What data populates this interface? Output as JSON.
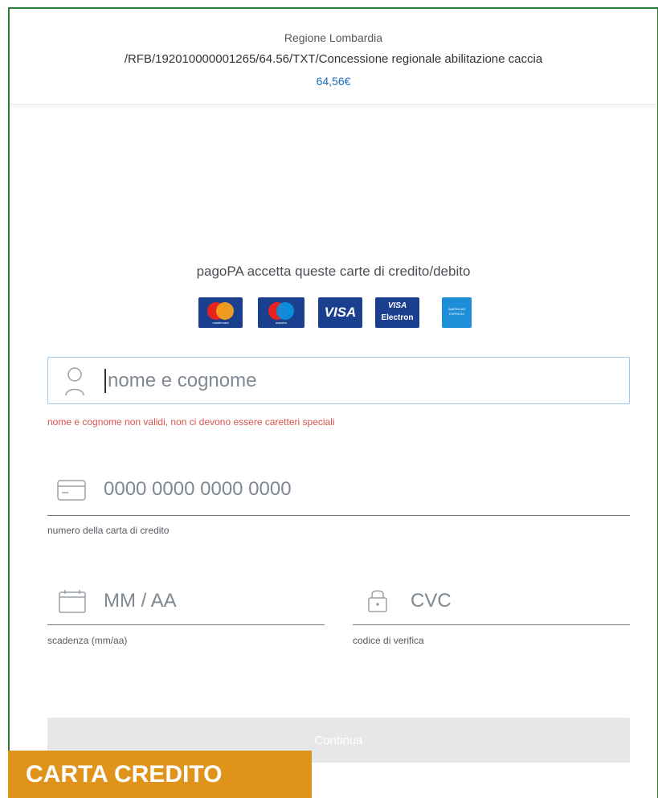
{
  "header": {
    "organization": "Regione Lombardia",
    "causale": "/RFB/192010000001265/64.56/TXT/Concessione regionale abilitazione caccia",
    "amount": "64,56€"
  },
  "accepted_cards": {
    "title": "pagoPA accetta queste carte di credito/debito",
    "logos": [
      {
        "name": "mastercard",
        "label": "mastercard"
      },
      {
        "name": "maestro",
        "label": "maestro"
      },
      {
        "name": "visa",
        "label": "VISA"
      },
      {
        "name": "visa-electron",
        "label_top": "VISA",
        "label_bottom": "Electron"
      },
      {
        "name": "american-express",
        "label": "AMERICAN EXPRESS"
      }
    ]
  },
  "form": {
    "name": {
      "placeholder": "nome e cognome",
      "value": "",
      "error": "nome e cognome non validi, non ci devono essere caretteri speciali",
      "icon": "user-icon"
    },
    "card_number": {
      "placeholder": "0000 0000 0000 0000",
      "value": "",
      "helper": "numero della carta di credito",
      "icon": "credit-card-icon"
    },
    "expiry": {
      "placeholder": "MM / AA",
      "value": "",
      "helper": "scadenza (mm/aa)",
      "icon": "calendar-icon"
    },
    "cvc": {
      "placeholder": "CVC",
      "value": "",
      "helper": "codice di verifica",
      "icon": "lock-icon"
    },
    "submit_label": "Continua"
  },
  "overlay": {
    "label": "CARTA CREDITO"
  },
  "colors": {
    "frame_border": "#2e7d32",
    "amount": "#1a6bb8",
    "error": "#d9534f",
    "overlay_bg": "#e0931a",
    "card_blue": "#1b3f8f"
  }
}
